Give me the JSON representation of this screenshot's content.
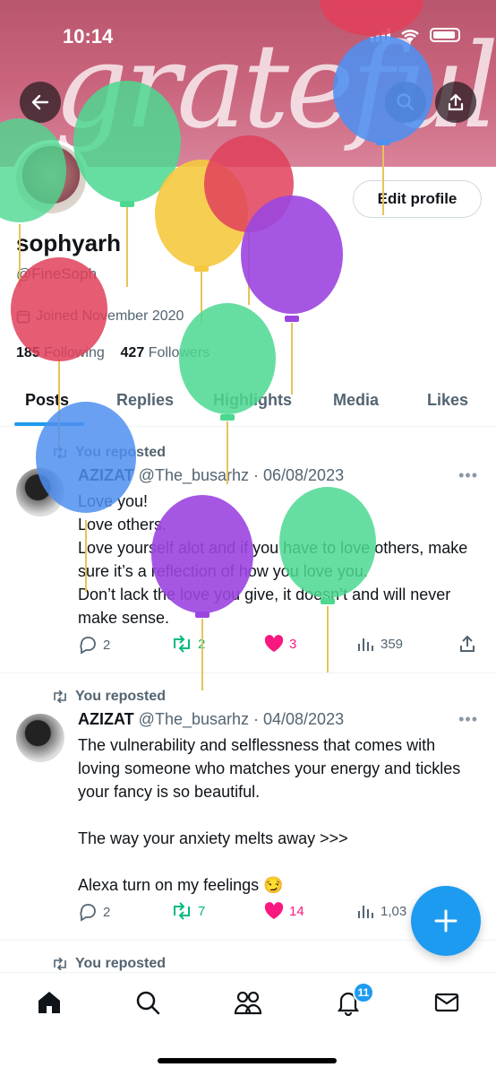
{
  "status": {
    "time": "10:14"
  },
  "banner": {
    "word": "grateful"
  },
  "profile": {
    "name": "sophyarh",
    "handle": "@FineSoph",
    "joined": "Joined November 2020",
    "following_count": "185",
    "following_label": "Following",
    "followers_count": "427",
    "followers_label": "Followers",
    "edit_label": "Edit profile"
  },
  "tabs": [
    "Posts",
    "Replies",
    "Highlights",
    "Media",
    "Likes"
  ],
  "posts": [
    {
      "repost_label": "You reposted",
      "author": "AZIZAT",
      "meta": "@The_busarhz · 06/08/2023",
      "text": "Love you!\nLove others.\nLove yourself alot and if you have to love others, make sure it’s a reflection of how you love you.\nDon’t lack the love you give, it doesn’t and will never make sense.",
      "replies": "2",
      "reposts": "2",
      "likes": "3",
      "views": "359"
    },
    {
      "repost_label": "You reposted",
      "author": "AZIZAT",
      "meta": "@The_busarhz · 04/08/2023",
      "text": "The vulnerability and selflessness that comes with loving someone who matches your energy and tickles your fancy is so beautiful.\n\nThe way your anxiety melts away >>>\n\nAlexa turn on my feelings 😏",
      "replies": "2",
      "reposts": "7",
      "likes": "14",
      "views": "1,03"
    },
    {
      "repost_label": "You reposted"
    }
  ],
  "nav": {
    "notifications_badge": "11"
  },
  "colors": {
    "accent": "#1d9bf0",
    "like": "#f91880",
    "repost": "#00ba7c"
  }
}
